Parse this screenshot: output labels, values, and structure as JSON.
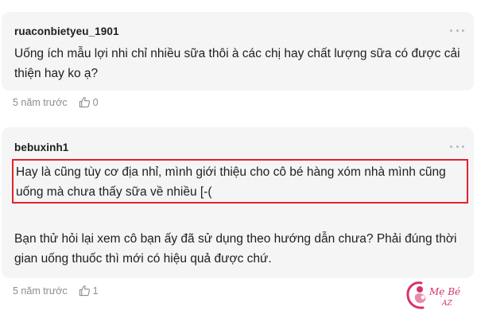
{
  "comments": [
    {
      "username": "ruaconbietyeu_1901",
      "text": "Uống ích mẫu lợi nhi chỉ nhiều sữa thôi à các chị hay chất lượng sữa có được cải thiện hay ko ạ?",
      "time": "5 năm trước",
      "likes": "0"
    },
    {
      "username": "bebuxinh1",
      "highlighted_text": "Hay là cũng tùy cơ địa nhỉ, mình giới thiệu cho cô bé hàng xóm nhà mình cũng uống mà chưa thấy sữa về nhiều [-(",
      "reply_text": "Bạn thử hỏi lại xem cô bạn ấy đã sử dụng theo hướng dẫn chưa? Phải đúng thời gian uống thuốc thì mới có hiệu quả được chứ.",
      "time": "5 năm trước",
      "likes": "1"
    }
  ],
  "icons": {
    "more": "more-dots-icon",
    "like": "thumbs-up-icon"
  },
  "logo": {
    "line1": "Mẹ Bé",
    "line2": "AZ"
  },
  "colors": {
    "card_background": "#f5f5f6",
    "highlight_border": "#e1232a",
    "meta_text": "#8c8c93",
    "logo_pink": "#d6336c"
  }
}
